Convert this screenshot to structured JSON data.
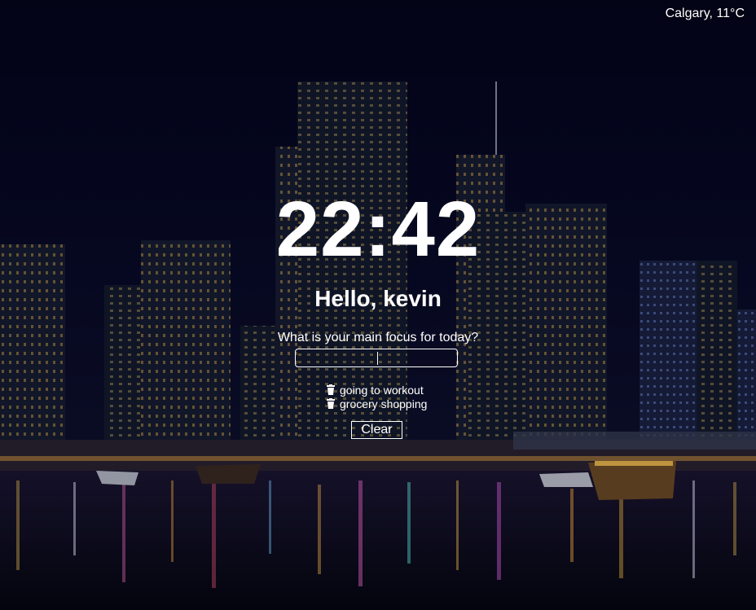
{
  "weather": {
    "text": "Calgary, 11°C"
  },
  "clock": {
    "time": "22:42"
  },
  "greeting": {
    "text": "Hello, kevin"
  },
  "focus": {
    "prompt": "What is your main focus for today?",
    "input_value": "",
    "placeholder": ""
  },
  "todos": [
    {
      "label": "going to workout",
      "icon": "trash-icon"
    },
    {
      "label": "grocery shopping",
      "icon": "trash-icon"
    }
  ],
  "clear_button": {
    "label": "Clear"
  },
  "background": {
    "subject": "night city skyline over marina",
    "sky_color": "#06061c",
    "water_color": "#0a0c1e"
  }
}
